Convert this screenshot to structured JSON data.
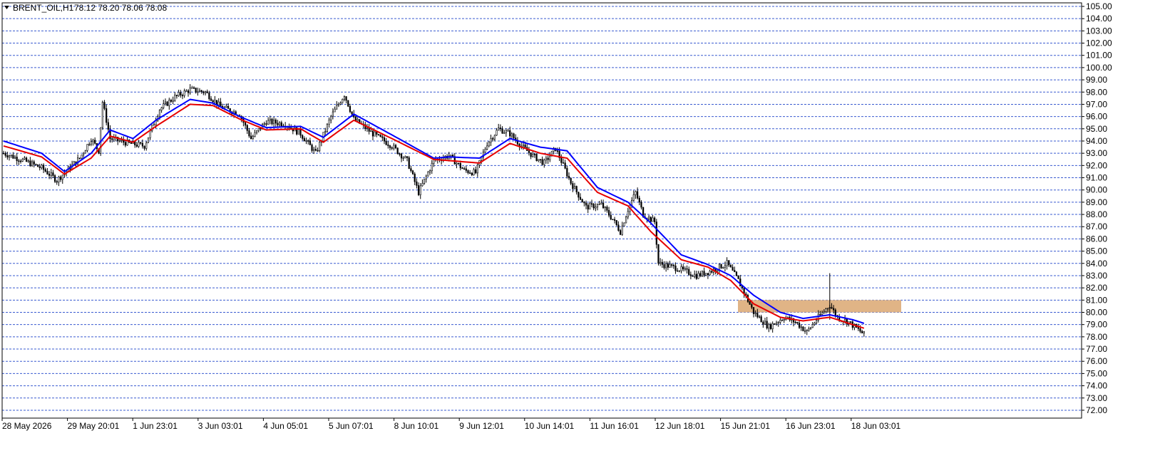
{
  "header": {
    "symbol": "BRENT_OIL,H1",
    "ohlc": "78.12 78.20 78.06 78.08"
  },
  "colors": {
    "background": "#ffffff",
    "grid": "#3a5bd0",
    "candles": "#000000",
    "ma_fast": "#e60000",
    "ma_slow": "#0000ff",
    "zone": "#e0b486",
    "frame": "#000000"
  },
  "chart_data": {
    "type": "candlestick",
    "price_axis": {
      "min": 72,
      "max": 105,
      "step": 1,
      "labels": [
        "105.00",
        "104.00",
        "103.00",
        "102.00",
        "101.00",
        "100.00",
        "99.00",
        "98.00",
        "97.00",
        "96.00",
        "95.00",
        "94.00",
        "93.00",
        "92.00",
        "91.00",
        "90.00",
        "89.00",
        "88.00",
        "87.00",
        "86.00",
        "85.00",
        "84.00",
        "83.00",
        "82.00",
        "81.00",
        "80.00",
        "79.00",
        "78.00",
        "77.00",
        "76.00",
        "75.00",
        "74.00",
        "73.00",
        "72.00"
      ]
    },
    "time_axis": {
      "labels": [
        "28 May 2026",
        "29 May 20:01",
        "1 Jun 23:01",
        "3 Jun 03:01",
        "4 Jun 05:01",
        "5 Jun 07:01",
        "8 Jun 10:01",
        "9 Jun 12:01",
        "10 Jun 14:01",
        "11 Jun 16:01",
        "12 Jun 18:01",
        "15 Jun 21:01",
        "16 Jun 23:01",
        "18 Jun 03:01"
      ]
    },
    "grid": true,
    "series": [
      {
        "kind": "candles",
        "anchors": [
          [
            0,
            93.0
          ],
          [
            9,
            92.5
          ],
          [
            20,
            91.8
          ],
          [
            28,
            90.8
          ],
          [
            32,
            91.4
          ],
          [
            40,
            92.6
          ],
          [
            46,
            94.2
          ],
          [
            50,
            93.2
          ],
          [
            52,
            97.2
          ],
          [
            56,
            94.2
          ],
          [
            66,
            93.8
          ],
          [
            74,
            93.6
          ],
          [
            82,
            96.6
          ],
          [
            90,
            97.6
          ],
          [
            98,
            98.2
          ],
          [
            106,
            98.0
          ],
          [
            114,
            96.8
          ],
          [
            124,
            96.2
          ],
          [
            130,
            94.2
          ],
          [
            138,
            95.6
          ],
          [
            148,
            95.4
          ],
          [
            156,
            94.6
          ],
          [
            164,
            93.0
          ],
          [
            172,
            96.0
          ],
          [
            179,
            97.8
          ],
          [
            184,
            95.8
          ],
          [
            194,
            94.6
          ],
          [
            204,
            93.6
          ],
          [
            212,
            92.4
          ],
          [
            218,
            89.8
          ],
          [
            226,
            92.4
          ],
          [
            234,
            92.8
          ],
          [
            242,
            91.6
          ],
          [
            248,
            91.4
          ],
          [
            254,
            93.8
          ],
          [
            260,
            95.0
          ],
          [
            266,
            94.6
          ],
          [
            272,
            93.6
          ],
          [
            278,
            92.8
          ],
          [
            284,
            92.2
          ],
          [
            290,
            93.4
          ],
          [
            298,
            90.6
          ],
          [
            306,
            88.6
          ],
          [
            314,
            88.8
          ],
          [
            320,
            87.6
          ],
          [
            324,
            86.6
          ],
          [
            328,
            88.4
          ],
          [
            332,
            89.8
          ],
          [
            336,
            88.0
          ],
          [
            342,
            87.4
          ],
          [
            344,
            84.0
          ],
          [
            354,
            83.6
          ],
          [
            364,
            83.0
          ],
          [
            372,
            83.4
          ],
          [
            380,
            84.0
          ],
          [
            386,
            82.6
          ],
          [
            394,
            80.0
          ],
          [
            402,
            78.8
          ],
          [
            410,
            79.6
          ],
          [
            416,
            79.2
          ],
          [
            422,
            78.4
          ],
          [
            428,
            79.6
          ],
          [
            434,
            80.6
          ],
          [
            438,
            79.6
          ],
          [
            444,
            79.2
          ],
          [
            452,
            78.2
          ]
        ]
      },
      {
        "kind": "moving-average",
        "anchors": [
          [
            0,
            94.0
          ],
          [
            20,
            93.0
          ],
          [
            32,
            91.5
          ],
          [
            46,
            93.0
          ],
          [
            56,
            94.9
          ],
          [
            68,
            94.2
          ],
          [
            80,
            95.7
          ],
          [
            98,
            97.4
          ],
          [
            110,
            97.1
          ],
          [
            124,
            96.0
          ],
          [
            138,
            95.1
          ],
          [
            156,
            95.2
          ],
          [
            168,
            94.3
          ],
          [
            184,
            96.2
          ],
          [
            204,
            94.5
          ],
          [
            226,
            92.6
          ],
          [
            234,
            92.7
          ],
          [
            250,
            92.6
          ],
          [
            266,
            94.2
          ],
          [
            282,
            93.5
          ],
          [
            296,
            93.2
          ],
          [
            312,
            90.2
          ],
          [
            328,
            89.0
          ],
          [
            340,
            87.3
          ],
          [
            356,
            84.7
          ],
          [
            370,
            83.9
          ],
          [
            382,
            83.0
          ],
          [
            394,
            81.4
          ],
          [
            408,
            80.0
          ],
          [
            420,
            79.5
          ],
          [
            434,
            79.8
          ],
          [
            446,
            79.4
          ],
          [
            452,
            79.1
          ]
        ]
      },
      {
        "kind": "moving-average",
        "anchors": [
          [
            0,
            93.6
          ],
          [
            20,
            92.7
          ],
          [
            32,
            91.3
          ],
          [
            46,
            92.6
          ],
          [
            56,
            94.4
          ],
          [
            68,
            93.9
          ],
          [
            80,
            95.2
          ],
          [
            98,
            97.0
          ],
          [
            110,
            96.9
          ],
          [
            124,
            95.8
          ],
          [
            138,
            94.9
          ],
          [
            156,
            95.0
          ],
          [
            168,
            93.9
          ],
          [
            184,
            95.7
          ],
          [
            204,
            94.2
          ],
          [
            226,
            92.5
          ],
          [
            234,
            92.4
          ],
          [
            250,
            92.2
          ],
          [
            266,
            93.8
          ],
          [
            282,
            93.0
          ],
          [
            296,
            92.6
          ],
          [
            312,
            89.8
          ],
          [
            328,
            88.7
          ],
          [
            340,
            86.6
          ],
          [
            356,
            84.3
          ],
          [
            370,
            83.7
          ],
          [
            382,
            82.6
          ],
          [
            394,
            80.7
          ],
          [
            408,
            79.6
          ],
          [
            420,
            79.3
          ],
          [
            434,
            79.6
          ],
          [
            446,
            79.0
          ],
          [
            452,
            78.7
          ]
        ]
      }
    ],
    "zones": [
      {
        "from": 80.0,
        "to": 81.0
      }
    ]
  }
}
